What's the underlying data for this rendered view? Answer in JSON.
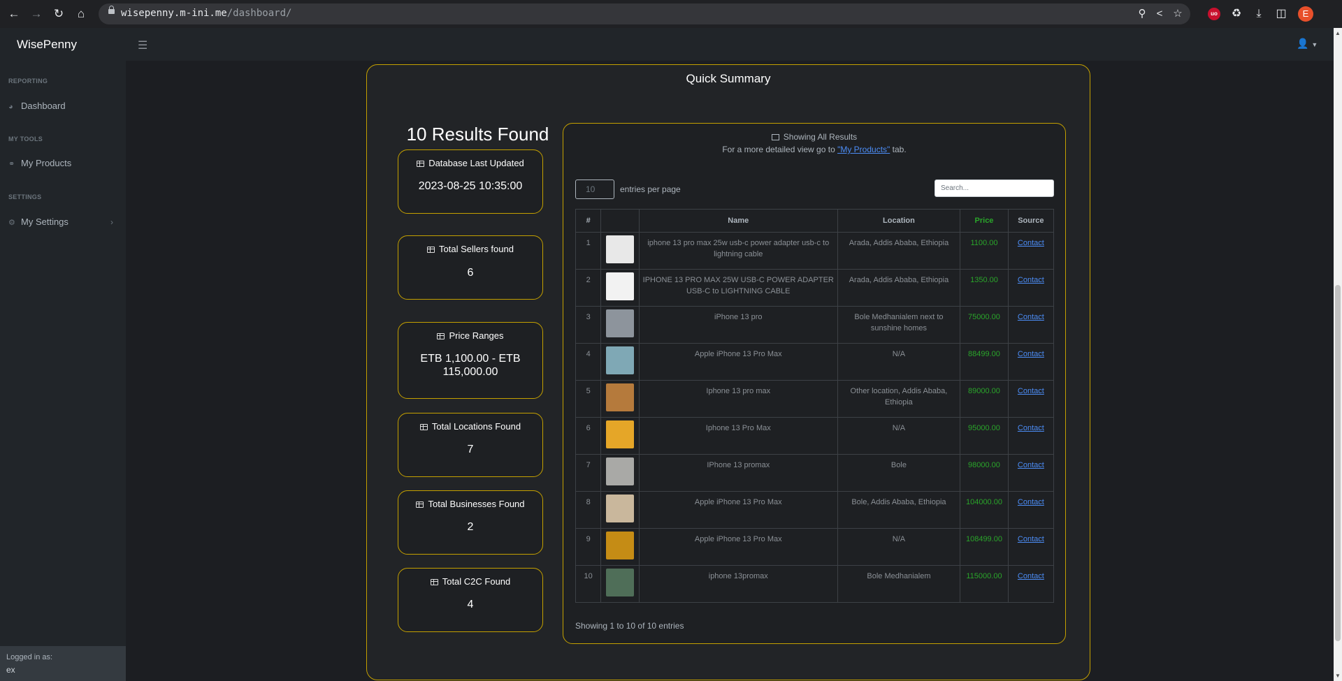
{
  "browser": {
    "url_host": "wisepenny.m-ini.me",
    "url_path": "/dashboard/",
    "profile_initial": "E",
    "extension_badge": "uo"
  },
  "app": {
    "brand": "WisePenny"
  },
  "sidebar": {
    "sections": [
      {
        "heading": "REPORTING",
        "item": "Dashboard",
        "icon": "dashboard-icon"
      },
      {
        "heading": "MY TOOLS",
        "item": "My Products",
        "icon": "link-icon"
      },
      {
        "heading": "SETTINGS",
        "item": "My Settings",
        "icon": "gear-icon"
      }
    ],
    "footer_label": "Logged in as:",
    "footer_user": "ex"
  },
  "summary": {
    "title": "Quick Summary",
    "results_title": "10 Results Found",
    "cards": [
      {
        "label": "Database Last Updated",
        "value": "2023-08-25 10:35:00"
      },
      {
        "label": "Total Sellers found",
        "value": "6"
      },
      {
        "label": "Price Ranges",
        "value": "ETB 1,100.00 - ETB 115,000.00"
      },
      {
        "label": "Total Locations Found",
        "value": "7"
      },
      {
        "label": "Total Businesses Found",
        "value": "2"
      },
      {
        "label": "Total C2C Found",
        "value": "4"
      }
    ]
  },
  "table": {
    "heading": "Showing All Results",
    "note_prefix": "For a more detailed view go to ",
    "note_link": "\"My Products\"",
    "note_suffix": " tab.",
    "entries_value": "10",
    "entries_label": "entries per page",
    "search_placeholder": "Search...",
    "columns": [
      "#",
      "",
      "Name",
      "Location",
      "Price",
      "Source"
    ],
    "rows": [
      {
        "num": "1",
        "name": "iphone 13 pro max 25w usb-c power adapter usb-c to lightning cable",
        "location": "Arada, Addis Ababa, Ethiopia",
        "price": "1100.00",
        "source": "Contact",
        "thumb": "#e8e8e8"
      },
      {
        "num": "2",
        "name": "IPHONE 13 PRO MAX 25W USB-C POWER ADAPTER USB-C to LIGHTNING CABLE",
        "location": "Arada, Addis Ababa, Ethiopia",
        "price": "1350.00",
        "source": "Contact",
        "thumb": "#f2f2f2"
      },
      {
        "num": "3",
        "name": "iPhone 13 pro",
        "location": "Bole Medhanialem next to sunshine homes",
        "price": "75000.00",
        "source": "Contact",
        "thumb": "#8d949c"
      },
      {
        "num": "4",
        "name": "Apple iPhone 13 Pro Max",
        "location": "N/A",
        "price": "88499.00",
        "source": "Contact",
        "thumb": "#7fa8b5"
      },
      {
        "num": "5",
        "name": "Iphone 13 pro max",
        "location": "Other location, Addis Ababa, Ethiopia",
        "price": "89000.00",
        "source": "Contact",
        "thumb": "#b57a3c"
      },
      {
        "num": "6",
        "name": "Iphone 13 Pro Max",
        "location": "N/A",
        "price": "95000.00",
        "source": "Contact",
        "thumb": "#e5a628"
      },
      {
        "num": "7",
        "name": "IPhone 13 promax",
        "location": "Bole",
        "price": "98000.00",
        "source": "Contact",
        "thumb": "#a9a9a6"
      },
      {
        "num": "8",
        "name": "Apple iPhone 13 Pro Max",
        "location": "Bole, Addis Ababa, Ethiopia",
        "price": "104000.00",
        "source": "Contact",
        "thumb": "#c9b79c"
      },
      {
        "num": "9",
        "name": "Apple iPhone 13 Pro Max",
        "location": "N/A",
        "price": "108499.00",
        "source": "Contact",
        "thumb": "#c58c15"
      },
      {
        "num": "10",
        "name": "iphone 13promax",
        "location": "Bole Medhanialem",
        "price": "115000.00",
        "source": "Contact",
        "thumb": "#4f6e58"
      }
    ],
    "footer": "Showing 1 to 10 of 10 entries"
  }
}
